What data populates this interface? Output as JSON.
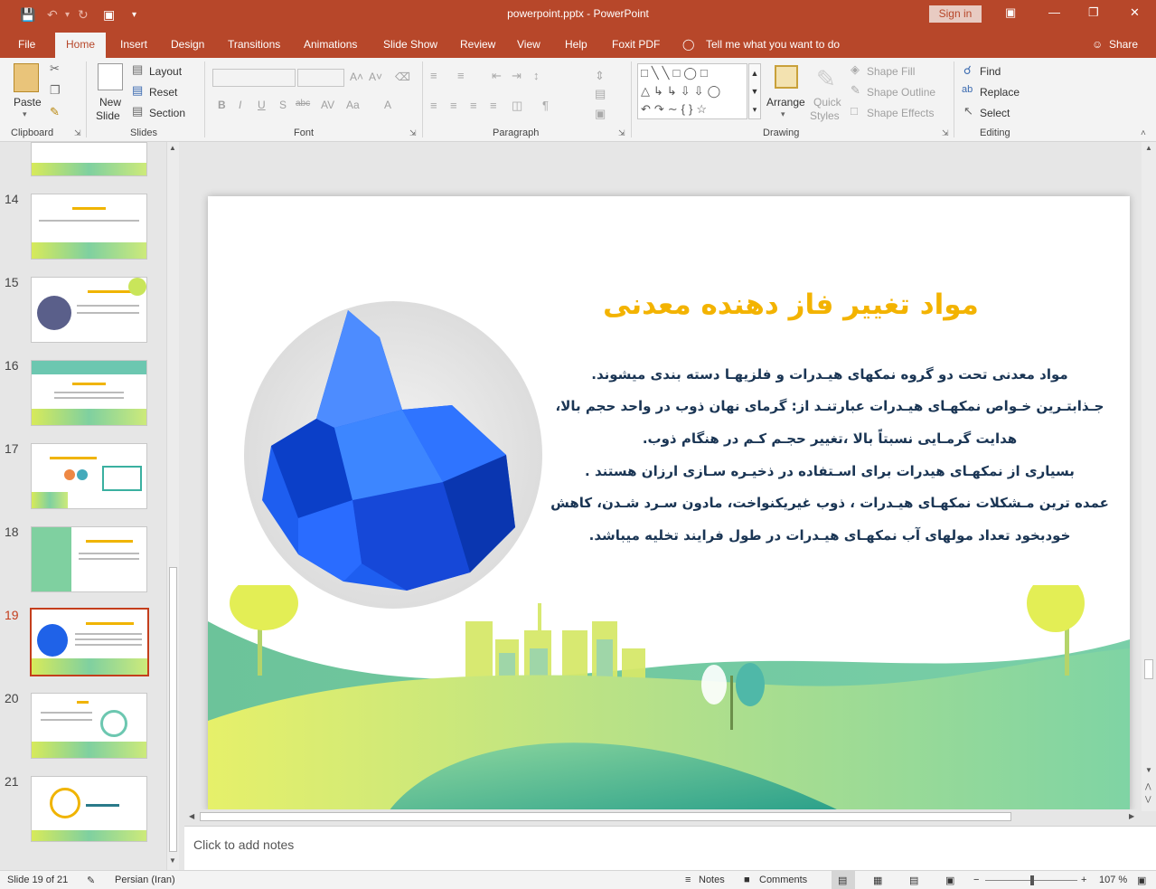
{
  "window": {
    "doc_title": "powerpoint.pptx - PowerPoint",
    "signin": "Sign in"
  },
  "tabs": [
    "File",
    "Home",
    "Insert",
    "Design",
    "Transitions",
    "Animations",
    "Slide Show",
    "Review",
    "View",
    "Help",
    "Foxit PDF",
    "Tell me what you want to do",
    "Share"
  ],
  "ribbon": {
    "clipboard": {
      "paste": "Paste",
      "label": "Clipboard"
    },
    "slides": {
      "new_slide_1": "New",
      "new_slide_2": "Slide",
      "layout": "Layout",
      "reset": "Reset",
      "section": "Section",
      "label": "Slides"
    },
    "font": {
      "label": "Font"
    },
    "paragraph": {
      "label": "Paragraph"
    },
    "drawing": {
      "arrange": "Arrange",
      "quick_1": "Quick",
      "quick_2": "Styles",
      "shape_fill": "Shape Fill",
      "shape_outline": "Shape Outline",
      "shape_effects": "Shape Effects",
      "label": "Drawing"
    },
    "editing": {
      "find": "Find",
      "replace": "Replace",
      "select": "Select",
      "label": "Editing"
    }
  },
  "thumbnails": [
    "14",
    "15",
    "16",
    "17",
    "18",
    "19",
    "20",
    "21"
  ],
  "selected_slide": "19",
  "slide": {
    "title": "مواد تغییر فاز دهنده معدنی",
    "lines": [
      "مواد معدنی تحت دو گروه نمکهای هیـدرات و فلزیهـا دسته بندی میشوند.",
      "جـذابتـرین خـواص نمکهـای هیـدرات عبارتنـد از: گرمای نهان ذوب در واحد حجم بالا،",
      "هدایت گرمـایی نسبتاً بالا ،تغییر حجـم کـم در هنگام ذوب.",
      "بسیاری از نمکهـای هیدرات برای اسـتفاده در ذخیـره سـازی ارزان هستند .",
      "عمده ترین مـشکلات نمکهـای هیـدرات ، ذوب غیریکنواخت، مادون سـرد شـدن، کاهش",
      "خودبخود تعداد مولهای آب نمکهـای هیـدرات در طول فرایند تخلیه میباشد."
    ]
  },
  "notes": {
    "placeholder": "Click to add notes"
  },
  "status": {
    "slide_info": "Slide 19 of 21",
    "language": "Persian (Iran)",
    "notes": "Notes",
    "comments": "Comments",
    "zoom": "107 %"
  }
}
